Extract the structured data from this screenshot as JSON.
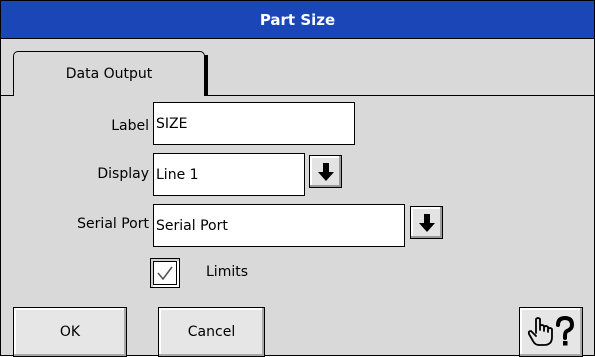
{
  "window": {
    "title": "Part Size"
  },
  "tabs": [
    {
      "label": "Data Output"
    }
  ],
  "form": {
    "label": {
      "label": "Label",
      "value": "SIZE"
    },
    "display": {
      "label": "Display",
      "value": "Line 1"
    },
    "serial_port": {
      "label": "Serial Port",
      "value": "Serial Port"
    },
    "limits": {
      "label": "Limits",
      "checked": true
    }
  },
  "buttons": {
    "ok": "OK",
    "cancel": "Cancel",
    "help_icon": "pointing-hand-question-icon"
  },
  "colors": {
    "titlebar": "#1b46b8",
    "background": "#d9d9d9"
  }
}
